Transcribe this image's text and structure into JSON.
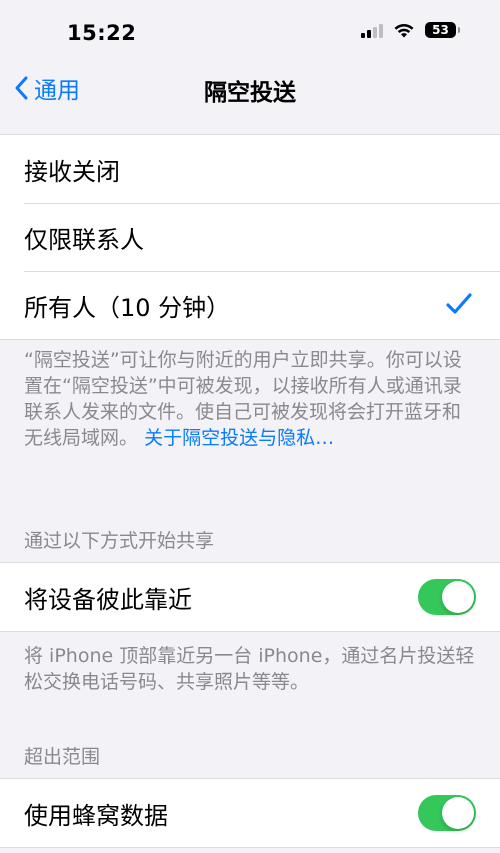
{
  "status_bar": {
    "time": "15:22",
    "battery": "53"
  },
  "nav": {
    "back_label": "通用",
    "title": "隔空投送"
  },
  "options": [
    {
      "label": "接收关闭",
      "checked": false
    },
    {
      "label": "仅限联系人",
      "checked": false
    },
    {
      "label": "所有人（10 分钟）",
      "checked": true
    }
  ],
  "description": {
    "text": "“隔空投送”可让你与附近的用户立即共享。你可以设置在“隔空投送”中可被发现，以接收所有人或通讯录联系人发来的文件。使自己可被发现将会打开蓝牙和无线局域网。",
    "link": "关于隔空投送与隐私…"
  },
  "share_section": {
    "header": "通过以下方式开始共享",
    "toggle_label": "将设备彼此靠近",
    "toggle_on": true,
    "footer": "将 iPhone 顶部靠近另一台 iPhone，通过名片投送轻松交换电话号码、共享照片等等。"
  },
  "range_section": {
    "header": "超出范围",
    "toggle_label": "使用蜂窝数据",
    "toggle_on": true
  },
  "colors": {
    "accent": "#0a7aff",
    "toggle_on": "#34c759",
    "background": "#f2f2f7"
  }
}
